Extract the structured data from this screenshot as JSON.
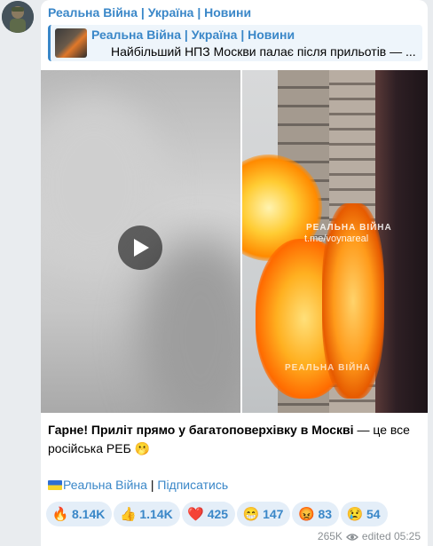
{
  "post": {
    "channel_name": "Реальна Війна | Україна | Новини",
    "reply": {
      "title": "Реальна Війна | Україна | Новини",
      "text": "Найбільший НПЗ Москви палає після прильотів — ..."
    },
    "media": {
      "watermark_top": "РЕАЛЬНА ВІЙНА",
      "watermark_link": "t.me/voynareal",
      "watermark_bottom": "РЕАЛЬНА ВІЙНА"
    },
    "caption": {
      "bold": "Гарне! Приліт прямо у багатоповерхівку в Москві",
      "rest": " — це все російська РЕБ 🫢"
    },
    "links": {
      "channel": "Реальна Війна",
      "separator": " | ",
      "subscribe": "Підписатись"
    },
    "reactions": [
      {
        "emoji": "🔥",
        "count": "8.14K"
      },
      {
        "emoji": "👍",
        "count": "1.14K"
      },
      {
        "emoji": "❤️",
        "count": "425"
      },
      {
        "emoji": "😁",
        "count": "147"
      },
      {
        "emoji": "😡",
        "count": "83"
      },
      {
        "emoji": "😢",
        "count": "54"
      }
    ],
    "meta": {
      "views": "265K",
      "edited": "edited",
      "time": "05:25"
    }
  },
  "colors": {
    "accent": "#3a87c8",
    "background": "#e9ecef",
    "bubble": "#ffffff",
    "reaction_bg": "#e4eef8"
  }
}
